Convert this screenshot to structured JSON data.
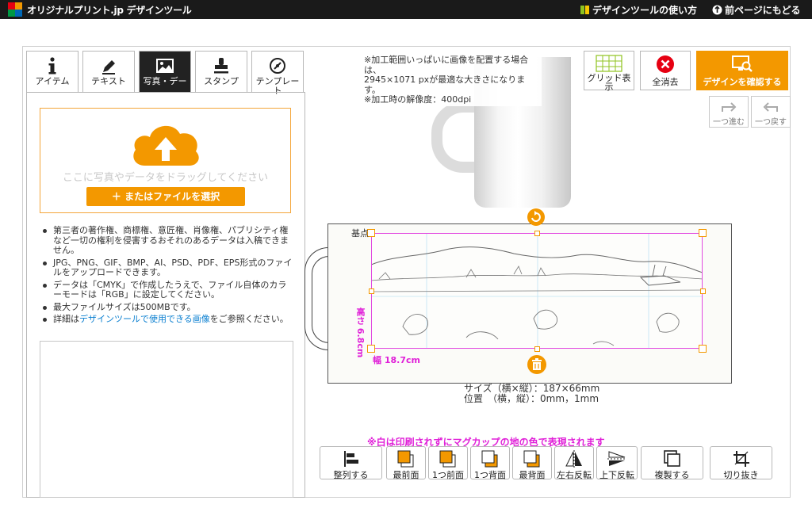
{
  "header": {
    "brand": "オリジナルプリント.jp デザインツール",
    "help_link": "デザインツールの使い方",
    "back_link": "前ページにもどる"
  },
  "tabs": [
    {
      "label": "アイテム",
      "icon": "info-icon"
    },
    {
      "label": "テキスト",
      "icon": "pen-icon"
    },
    {
      "label": "写真・デー",
      "icon": "image-icon",
      "active": true
    },
    {
      "label": "スタンプ",
      "icon": "stamp-icon"
    },
    {
      "label": "テンプレー\nト",
      "icon": "template-icon"
    }
  ],
  "upload": {
    "drop_text": "ここに写真やデータをドラッグしてください",
    "select_button": "＋ またはファイルを選択"
  },
  "notes": [
    "第三者の著作権、商標権、意匠権、肖像権、パブリシティ権など一切の権利を侵害するおそれのあるデータは入稿できません。",
    "JPG、PNG、GIF、BMP、AI、PSD、PDF、EPS形式のファイルをアップロードできます。",
    "データは「CMYK」で作成したうえで、ファイル自体のカラーモードは「RGB」に設定してください。",
    "最大ファイルサイズは500MBです。"
  ],
  "note_link": {
    "prefix": "詳細は",
    "link": "デザインツールで使用できる画像",
    "suffix": "をご参照ください。"
  },
  "print_notice": {
    "line1": "※加工範囲いっぱいに画像を配置する場合は、",
    "line2": "2945×1071 pxが最適な大きさになります。",
    "line3": "※加工時の解像度：400dpi"
  },
  "toolbar": {
    "grid": "グリッド表示",
    "clear": "全消去",
    "confirm": "デザインを確認する",
    "redo": "一つ進む",
    "undo": "一つ戻す"
  },
  "canvas": {
    "base_point": "基点",
    "width": "幅 18.7cm",
    "height": "高さ 6.8cm",
    "size_line": "サイズ（横×縦）：187×66mm",
    "position_line": "位置　（横，縦）：0mm，1mm"
  },
  "white_note": "※白は印刷されずにマグカップの地の色で表現されます",
  "bottom_toolbar": {
    "align": "整列する",
    "front_most": "最前面",
    "forward": "1つ前面",
    "backward": "1つ背面",
    "back_most": "最背面",
    "flip_h": "左右反転",
    "flip_v": "上下反転",
    "duplicate": "複製する",
    "crop": "切り抜き"
  },
  "colors": {
    "accent": "#f39800",
    "selection": "#e24ae0",
    "link": "#0a7fd0"
  }
}
